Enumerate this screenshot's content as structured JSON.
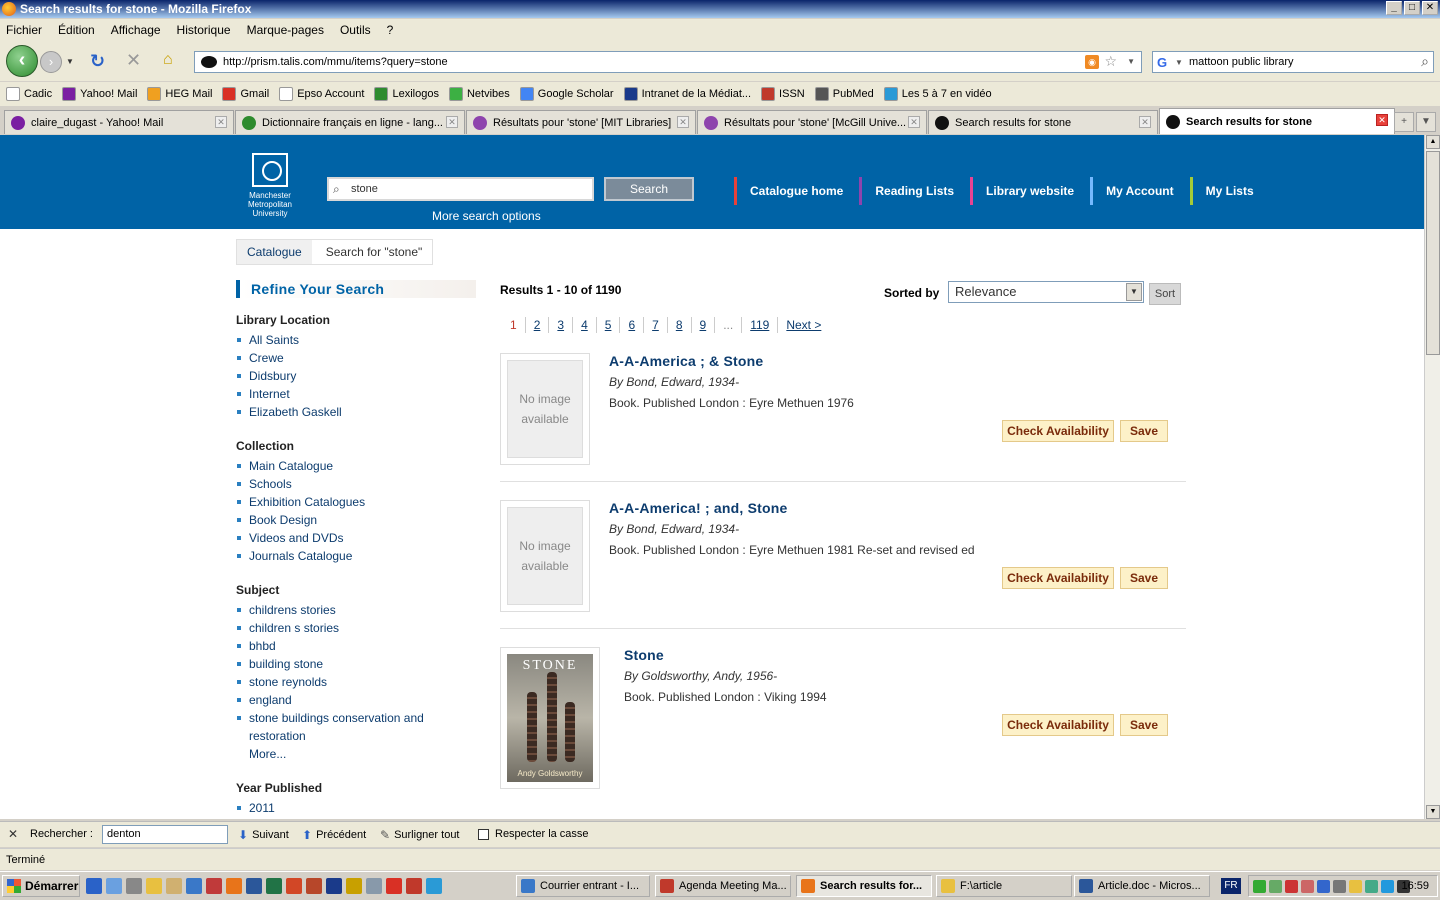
{
  "window": {
    "title": "Search results for stone - Mozilla Firefox",
    "min": "_",
    "max": "□",
    "close": "✕"
  },
  "menu": [
    "Fichier",
    "Édition",
    "Affichage",
    "Historique",
    "Marque-pages",
    "Outils",
    "?"
  ],
  "nav": {
    "url": "http://prism.talis.com/mmu/items?query=stone",
    "search_engine_text": "mattoon public library",
    "rss_label": "RSS"
  },
  "bookmarks": [
    {
      "label": "Cadic",
      "color": "#ffffff"
    },
    {
      "label": "Yahoo! Mail",
      "color": "#7b1fa2"
    },
    {
      "label": "HEG Mail",
      "color": "#f0a020"
    },
    {
      "label": "Gmail",
      "color": "#d93025"
    },
    {
      "label": "Epso Account",
      "color": "#ffffff"
    },
    {
      "label": "Lexilogos",
      "color": "#2e8b2e"
    },
    {
      "label": "Netvibes",
      "color": "#3cb043"
    },
    {
      "label": "Google Scholar",
      "color": "#4285f4"
    },
    {
      "label": "Intranet de la Médiat...",
      "color": "#1a3a8a"
    },
    {
      "label": "ISSN",
      "color": "#c0392b"
    },
    {
      "label": "PubMed",
      "color": "#555555"
    },
    {
      "label": "Les 5 à 7 en vidéo",
      "color": "#2a9ad6"
    }
  ],
  "tabs": [
    {
      "label": "claire_dugast - Yahoo! Mail",
      "color": "#7b1fa2",
      "active": false
    },
    {
      "label": "Dictionnaire français en ligne - lang...",
      "color": "#2e8b2e",
      "active": false
    },
    {
      "label": "Résultats pour 'stone' [MIT Libraries]",
      "color": "#8e44ad",
      "active": false
    },
    {
      "label": "Résultats pour 'stone' [McGill Unive...",
      "color": "#8e44ad",
      "active": false
    },
    {
      "label": "Search results for stone",
      "color": "#111111",
      "active": false
    },
    {
      "label": "Search results for stone",
      "color": "#111111",
      "active": true
    }
  ],
  "site": {
    "logo_text": [
      "Manchester",
      "Metropolitan",
      "University"
    ],
    "search_value": "stone",
    "search_button": "Search",
    "more_search": "More search options",
    "nav": [
      {
        "label": "Catalogue home",
        "color": "#e8413a"
      },
      {
        "label": "Reading Lists",
        "color": "#8e44ad"
      },
      {
        "label": "Library website",
        "color": "#e84393"
      },
      {
        "label": "My Account",
        "color": "#74b9ff"
      },
      {
        "label": "My Lists",
        "color": "#a3cb38"
      }
    ]
  },
  "breadcrumb": {
    "link": "Catalogue",
    "current": "Search for \"stone\""
  },
  "sidebar": {
    "title": "Refine Your Search",
    "facets": [
      {
        "title": "Library Location",
        "items": [
          "All Saints",
          "Crewe",
          "Didsbury",
          "Internet",
          "Elizabeth Gaskell"
        ]
      },
      {
        "title": "Collection",
        "items": [
          "Main Catalogue",
          "Schools",
          "Exhibition Catalogues",
          "Book Design",
          "Videos and DVDs",
          "Journals Catalogue"
        ]
      },
      {
        "title": "Subject",
        "items": [
          "childrens stories",
          "children s stories",
          "bhbd",
          "building stone",
          "stone reynolds",
          "england",
          "stone buildings conservation and",
          "restoration"
        ],
        "more": "More..."
      },
      {
        "title": "Year Published",
        "items": [
          "2011"
        ]
      }
    ]
  },
  "results": {
    "count_text": "Results 1 - 10 of 1190",
    "sorted_by": "Sorted by",
    "sort_value": "Relevance",
    "sort_button": "Sort",
    "pages": [
      "1",
      "2",
      "3",
      "4",
      "5",
      "6",
      "7",
      "8",
      "9",
      "...",
      "119",
      "Next >"
    ],
    "no_image_text": "No image available",
    "check_label": "Check Availability",
    "save_label": "Save",
    "items": [
      {
        "title": "A-A-America ; & Stone",
        "author": "By Bond, Edward, 1934-",
        "pub": "Book. Published London : Eyre Methuen 1976",
        "has_cover": false
      },
      {
        "title": "A-A-America! ; and, Stone",
        "author": "By Bond, Edward, 1934-",
        "pub": "Book. Published London : Eyre Methuen 1981 Re-set and revised ed",
        "has_cover": false
      },
      {
        "title": "Stone",
        "author": "By Goldsworthy, Andy, 1956-",
        "pub": "Book. Published London : Viking 1994",
        "has_cover": true,
        "cover_title": "STONE",
        "cover_author": "Andy Goldsworthy"
      }
    ]
  },
  "findbar": {
    "close": "✕",
    "label": "Rechercher :",
    "value": "denton",
    "next": "Suivant",
    "prev": "Précédent",
    "highlight": "Surligner tout",
    "match_case": "Respecter la casse"
  },
  "status": "Terminé",
  "taskbar": {
    "start": "Démarrer",
    "tasks": [
      {
        "label": "Courrier entrant - I...",
        "active": false
      },
      {
        "label": "Agenda Meeting Ma...",
        "active": false
      },
      {
        "label": "Search results for...",
        "active": true
      },
      {
        "label": "F:\\article",
        "active": false
      },
      {
        "label": "Article.doc - Micros...",
        "active": false
      }
    ],
    "lang": "FR",
    "clock": "16:59"
  }
}
